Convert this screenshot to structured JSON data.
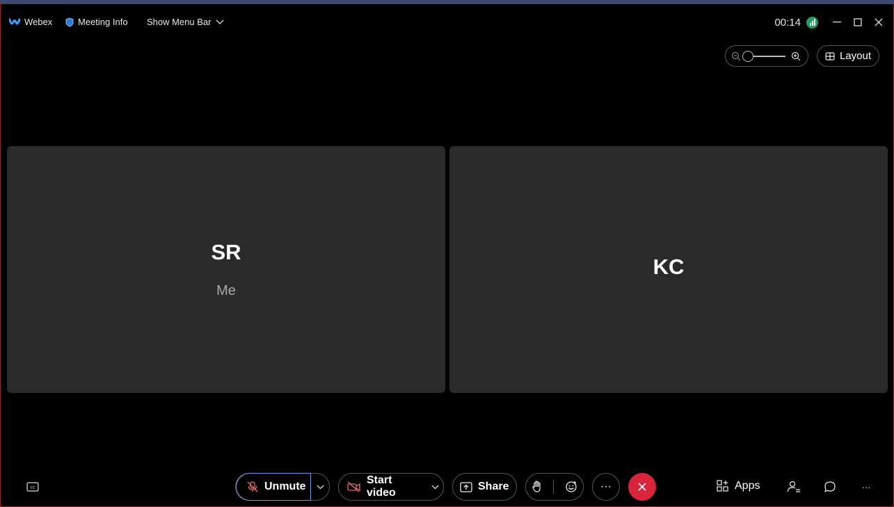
{
  "titlebar": {
    "app_name": "Webex",
    "meeting_info": "Meeting Info",
    "show_menu_bar": "Show Menu Bar",
    "timer": "00:14"
  },
  "view_controls": {
    "layout_label": "Layout"
  },
  "participants": [
    {
      "initials": "SR",
      "label": "Me"
    },
    {
      "initials": "KC",
      "label": ""
    }
  ],
  "controls": {
    "unmute_label": "Unmute",
    "start_video_label": "Start video",
    "share_label": "Share",
    "more_label": "···",
    "apps_label": "Apps",
    "right_more_label": "···"
  },
  "colors": {
    "leave": "#d9253b",
    "tile": "#2a2a2a",
    "signal": "#1e9e63",
    "focus_ring": "#6f9ee6"
  }
}
